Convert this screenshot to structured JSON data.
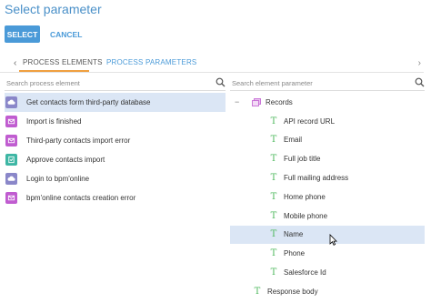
{
  "dialog": {
    "title": "Select parameter",
    "select_label": "SELECT",
    "cancel_label": "CANCEL"
  },
  "tabs": {
    "prev_arrow": "‹",
    "next_arrow": "›",
    "items": [
      {
        "label": "PROCESS ELEMENTS",
        "active": true
      },
      {
        "label": "PROCESS PARAMETERS",
        "active": false
      }
    ]
  },
  "left": {
    "search_placeholder": "Search process element",
    "items": [
      {
        "label": "Get contacts form third-party database",
        "icon": "cloud-icon",
        "color": "#8a87c9",
        "selected": true
      },
      {
        "label": "Import is finished",
        "icon": "message-icon",
        "color": "#c05cd0",
        "selected": false
      },
      {
        "label": "Third-party contacts import error",
        "icon": "message-icon",
        "color": "#c05cd0",
        "selected": false
      },
      {
        "label": "Approve contacts import",
        "icon": "approval-icon",
        "color": "#3db6a4",
        "selected": false
      },
      {
        "label": "Login to bpm'online",
        "icon": "cloud-icon",
        "color": "#8a87c9",
        "selected": false
      },
      {
        "label": "bpm'online contacts creation error",
        "icon": "message-icon",
        "color": "#c05cd0",
        "selected": false
      }
    ]
  },
  "right": {
    "search_placeholder": "Search element parameter",
    "collapse_symbol": "−",
    "text_type_glyph": "T",
    "records_label": "Records",
    "fields": [
      {
        "label": "API record URL",
        "selected": false
      },
      {
        "label": "Email",
        "selected": false
      },
      {
        "label": "Full job title",
        "selected": false
      },
      {
        "label": "Full mailing address",
        "selected": false
      },
      {
        "label": "Home phone",
        "selected": false
      },
      {
        "label": "Mobile phone",
        "selected": false
      },
      {
        "label": "Name",
        "selected": true
      },
      {
        "label": "Phone",
        "selected": false
      },
      {
        "label": "Salesforce Id",
        "selected": false
      }
    ],
    "response_body_label": "Response body"
  },
  "colors": {
    "accent": "#4a9ad8",
    "tab_underline": "#f0a040",
    "selection": "#dbe6f5",
    "text_type": "#4db85c"
  }
}
